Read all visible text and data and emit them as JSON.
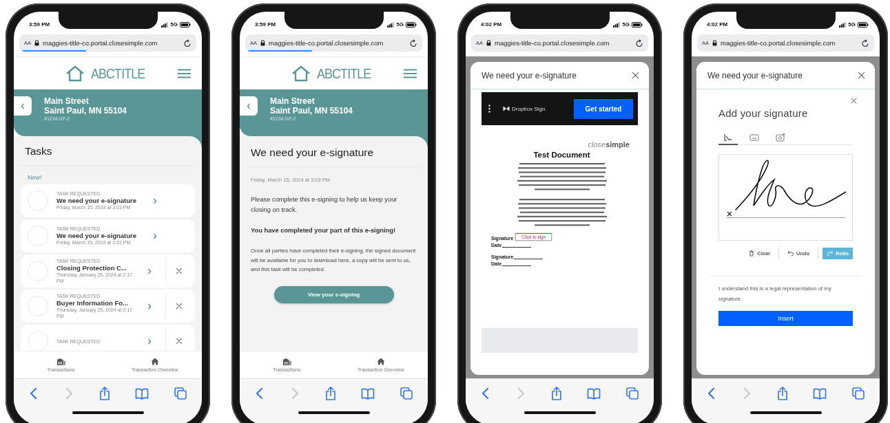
{
  "phones": [
    {
      "kind": "tasks",
      "status": {
        "time": "3:59 PM",
        "network": "5G"
      },
      "url": {
        "text_size": "AA",
        "address": "maggies-title-co.portal.closesimple.com",
        "level": 0.36
      },
      "logo": "ABCTITLE",
      "property": {
        "street": "Main Street",
        "city": "Saint Paul, MN 55104",
        "number": "#1234-SP-2"
      },
      "tasks_page": {
        "title": "Tasks",
        "section": "New!",
        "tasks": [
          {
            "eyebrow": "TASK REQUESTED",
            "title": "We need your e-signature",
            "date": "Friday, March 15, 2024 at 3:03 PM",
            "dismissible": false
          },
          {
            "eyebrow": "TASK REQUESTED",
            "title": "We need your e-signature",
            "date": "Friday, March 15, 2024 at 2:31 PM",
            "dismissible": false
          },
          {
            "eyebrow": "TASK REQUESTED",
            "title": "Closing Protection C...",
            "date": "Thursday, January 25, 2024 at 2:17 PM",
            "dismissible": true
          },
          {
            "eyebrow": "TASK REQUESTED",
            "title": "Buyer Information Fo...",
            "date": "Thursday, January 25, 2024 at 2:17 PM",
            "dismissible": true
          },
          {
            "eyebrow": "TASK REQUESTED",
            "dismissible": true
          }
        ]
      },
      "nav": [
        {
          "label": "Transactions"
        },
        {
          "label": "Transaction Overview"
        }
      ],
      "toolbar": [
        {
          "disabled": false
        },
        {
          "disabled": true
        },
        {
          "disabled": false
        },
        {
          "disabled": false
        },
        {
          "disabled": false
        }
      ]
    },
    {
      "kind": "detail",
      "status": {
        "time": "3:59 PM",
        "network": "5G"
      },
      "url": {
        "text_size": "AA",
        "address": "maggies-title-co.portal.closesimple.com",
        "level": 0.36
      },
      "logo": "ABCTITLE",
      "property": {
        "street": "Main Street",
        "city": "Saint Paul, MN 55104",
        "number": "#1234-SP-2"
      },
      "detail": {
        "title": "We need your e-signature",
        "date": "Friday, March 15, 2024 at 3:03 PM",
        "message": "Please complete this e-signing to help us keep your closing on track.",
        "notice": "You have completed your part of this e-signing!",
        "info": "Once all parties have completed their e-signing, the signed document will be available for you to download here, a copy will be sent to us, and this task will be completed.",
        "button": "View your e-signing"
      },
      "nav": [
        {
          "label": "Transactions"
        },
        {
          "label": "Transaction Overview"
        }
      ],
      "toolbar": [
        {
          "disabled": false
        },
        {
          "disabled": true
        },
        {
          "disabled": false
        },
        {
          "disabled": false
        },
        {
          "disabled": false
        }
      ]
    },
    {
      "kind": "document",
      "status": {
        "time": "4:02 PM",
        "network": "5G"
      },
      "url": {
        "text_size": "AA",
        "address": "maggies-title-co.portal.closesimple.com"
      },
      "modal": {
        "title": "We need your e-signature"
      },
      "viewer": {
        "brand": "Dropbox Sign",
        "action": "Get started",
        "doc_logo": "close**simple**",
        "doc_title": "Test Document",
        "fields": [
          {
            "label": "Signature",
            "kind": "sign",
            "prompt": "Click to sign"
          },
          {
            "label": "Date",
            "kind": "line"
          },
          {
            "label": "Signature",
            "kind": "line"
          },
          {
            "label": "Date",
            "kind": "line"
          }
        ]
      },
      "toolbar": [
        {
          "disabled": false
        },
        {
          "disabled": true
        },
        {
          "disabled": false
        },
        {
          "disabled": false
        },
        {
          "disabled": false
        }
      ]
    },
    {
      "kind": "signature",
      "status": {
        "time": "4:02 PM",
        "network": "5G"
      },
      "url": {
        "text_size": "AA",
        "address": "maggies-title-co.portal.closesimple.com"
      },
      "modal": {
        "title": "We need your e-signature"
      },
      "signature": {
        "title": "Add your signature",
        "tabs": [
          {
            "selected": true
          },
          {
            "selected": false
          },
          {
            "selected": false
          }
        ],
        "actions": [
          {
            "label": "Clear",
            "highlighted": false
          },
          {
            "label": "Undo",
            "highlighted": false
          },
          {
            "label": "Redo",
            "highlighted": true
          }
        ],
        "consent": "I understand this is a legal representation of my signature.",
        "button": "Insert"
      },
      "toolbar": [
        {
          "disabled": false
        },
        {
          "disabled": true
        },
        {
          "disabled": false
        },
        {
          "disabled": false
        },
        {
          "disabled": false
        }
      ]
    }
  ]
}
